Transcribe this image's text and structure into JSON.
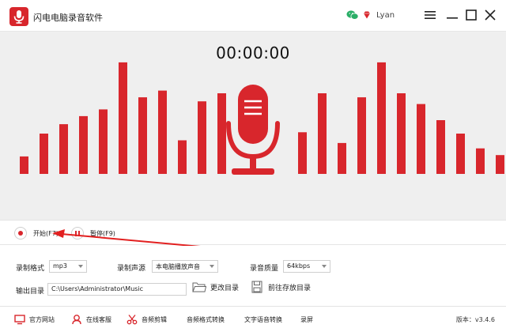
{
  "window": {
    "title": "闪电电脑录音软件",
    "username": "Lyan",
    "icons": [
      "app-mic-logo-icon",
      "wechat-icon",
      "vip-diamond-icon",
      "menu-icon",
      "minimize-icon",
      "maximize-icon",
      "close-icon"
    ]
  },
  "recorder": {
    "timer": "00:00:00",
    "level_bars": [
      [
        0.13,
        0.3,
        0.37,
        0.43,
        0.48,
        0.83,
        0.57,
        0.62,
        0.25,
        0.54,
        0.6
      ],
      [
        0.31,
        0.6,
        0.23,
        0.57,
        0.83,
        0.6,
        0.52,
        0.4,
        0.3,
        0.19,
        0.14
      ]
    ],
    "accent_color": "#d8262c"
  },
  "controls": {
    "start_label": "开始(F7)",
    "pause_label": "暂停(F9)"
  },
  "settings": {
    "format_label": "录制格式",
    "format_value": "mp3",
    "source_label": "录制声源",
    "source_value": "本电脑播放声音",
    "quality_label": "录音质量",
    "quality_value": "64kbps",
    "output_label": "输出目录",
    "output_path": "C:\\Users\\Administrator\\Music",
    "change_dir_label": "更改目录",
    "open_dir_label": "前往存放目录"
  },
  "footer": {
    "items": [
      {
        "label": "官方网站",
        "icon": "monitor-icon"
      },
      {
        "label": "在线客服",
        "icon": "headset-icon"
      },
      {
        "label": "音频剪辑",
        "icon": "scissors-icon"
      },
      {
        "label": "音频格式转换",
        "icon": ""
      },
      {
        "label": "文字语音转换",
        "icon": ""
      },
      {
        "label": "录屏",
        "icon": ""
      }
    ],
    "version": "版本：v3.4.6"
  }
}
